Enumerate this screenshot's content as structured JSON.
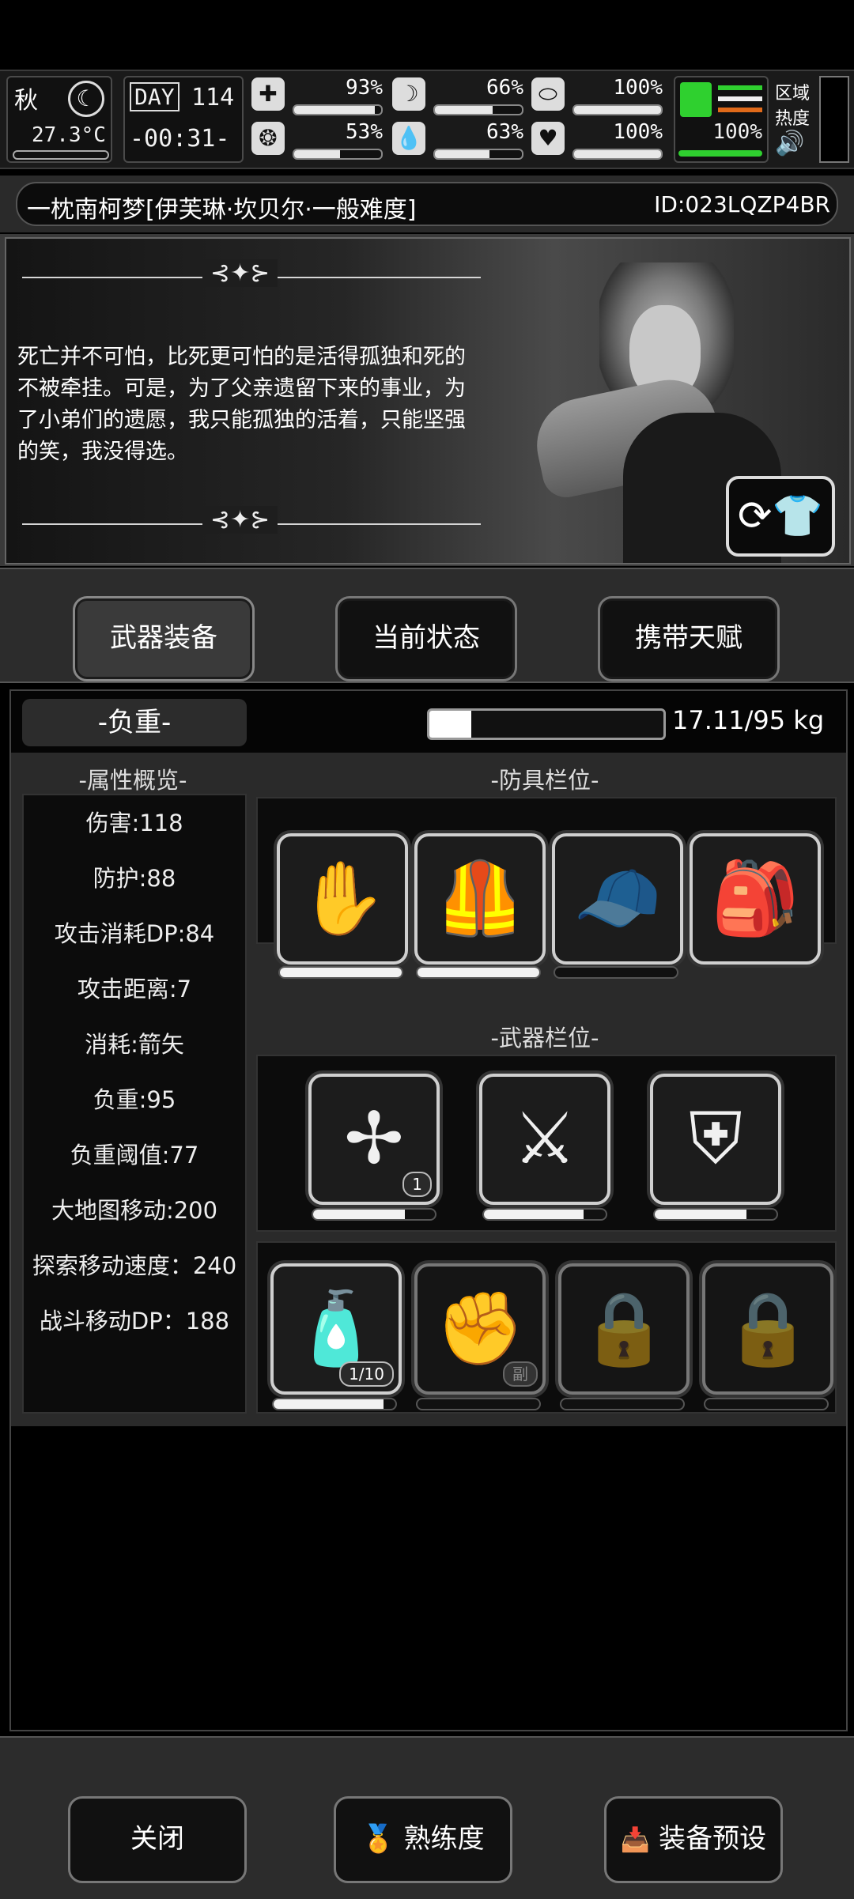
{
  "hud": {
    "season": "秋",
    "temperature": "27.3°C",
    "day_label": "DAY",
    "day_number": "114",
    "time": "-00:31-",
    "stats": [
      {
        "icon": "medkit-icon",
        "glyph": "✚",
        "value": "93%",
        "fill": 0.93
      },
      {
        "icon": "stomach-icon",
        "glyph": "☽",
        "value": "66%",
        "fill": 0.66
      },
      {
        "icon": "pill-icon",
        "glyph": "⬭",
        "value": "100%",
        "fill": 1.0
      },
      {
        "icon": "brain-icon",
        "glyph": "❂",
        "value": "53%",
        "fill": 0.53
      },
      {
        "icon": "water-drop-icon",
        "glyph": "💧",
        "value": "63%",
        "fill": 0.63
      },
      {
        "icon": "heart-icon",
        "glyph": "♥",
        "value": "100%",
        "fill": 1.0
      }
    ],
    "stamina_value": "100%",
    "stamina_fill": 1.0,
    "zone_label_1": "区域",
    "zone_label_2": "热度"
  },
  "title": {
    "name": "一枕南柯梦[伊芙琳·坎贝尔·一般难度]",
    "id": "ID:023LQZP4BR"
  },
  "story": {
    "quote": "死亡并不可怕，比死更可怕的是活得孤独和死的不被牵挂。可是，为了父亲遗留下来的事业，为了小弟们的遗愿，我只能孤独的活着，只能坚强的笑，我没得选。"
  },
  "tabs": [
    "武器装备",
    "当前状态",
    "携带天赋"
  ],
  "weight": {
    "label": "-负重-",
    "text": "17.11/95 kg",
    "fill": 0.18
  },
  "attributes": {
    "header": "-属性概览-",
    "items": [
      "伤害:118",
      "防护:88",
      "攻击消耗DP:84",
      "攻击距离:7",
      "消耗:箭矢",
      "负重:95",
      "负重阈值:77",
      "大地图移动:200",
      "探索移动速度：240",
      "战斗移动DP：188"
    ]
  },
  "armor": {
    "header": "-防具栏位-",
    "slots": [
      {
        "name": "gloves-icon",
        "glyph": "✋",
        "durability": 1.0
      },
      {
        "name": "vest-icon",
        "glyph": "🦺",
        "durability": 1.0
      },
      {
        "name": "cap-icon",
        "glyph": "🧢",
        "durability": 0.0
      },
      {
        "name": "backpack-icon",
        "glyph": "🎒",
        "durability": 1.0
      }
    ]
  },
  "weapons": {
    "header": "-武器栏位-",
    "slots": [
      {
        "name": "crossbow-icon",
        "glyph": "✢",
        "durability": 0.75,
        "badge": "1"
      },
      {
        "name": "katana-icon",
        "glyph": "⚔",
        "durability": 0.82,
        "badge": ""
      },
      {
        "name": "shield-icon",
        "glyph": "⛨",
        "durability": 0.75,
        "badge": ""
      }
    ]
  },
  "items": {
    "slots": [
      {
        "name": "bottle-icon",
        "glyph": "🧴",
        "durability": 0.9,
        "badge": "1/10",
        "dim": false
      },
      {
        "name": "fist-icon",
        "glyph": "✊",
        "durability": 0.0,
        "badge": "副",
        "dim": true
      },
      {
        "name": "lock-icon",
        "glyph": "🔒",
        "durability": 0.0,
        "badge": "",
        "dim": true
      },
      {
        "name": "lock-icon",
        "glyph": "🔒",
        "durability": 0.0,
        "badge": "",
        "dim": true
      }
    ]
  },
  "footer": {
    "close": "关闭",
    "proficiency": "熟练度",
    "preset": "装备预设"
  }
}
